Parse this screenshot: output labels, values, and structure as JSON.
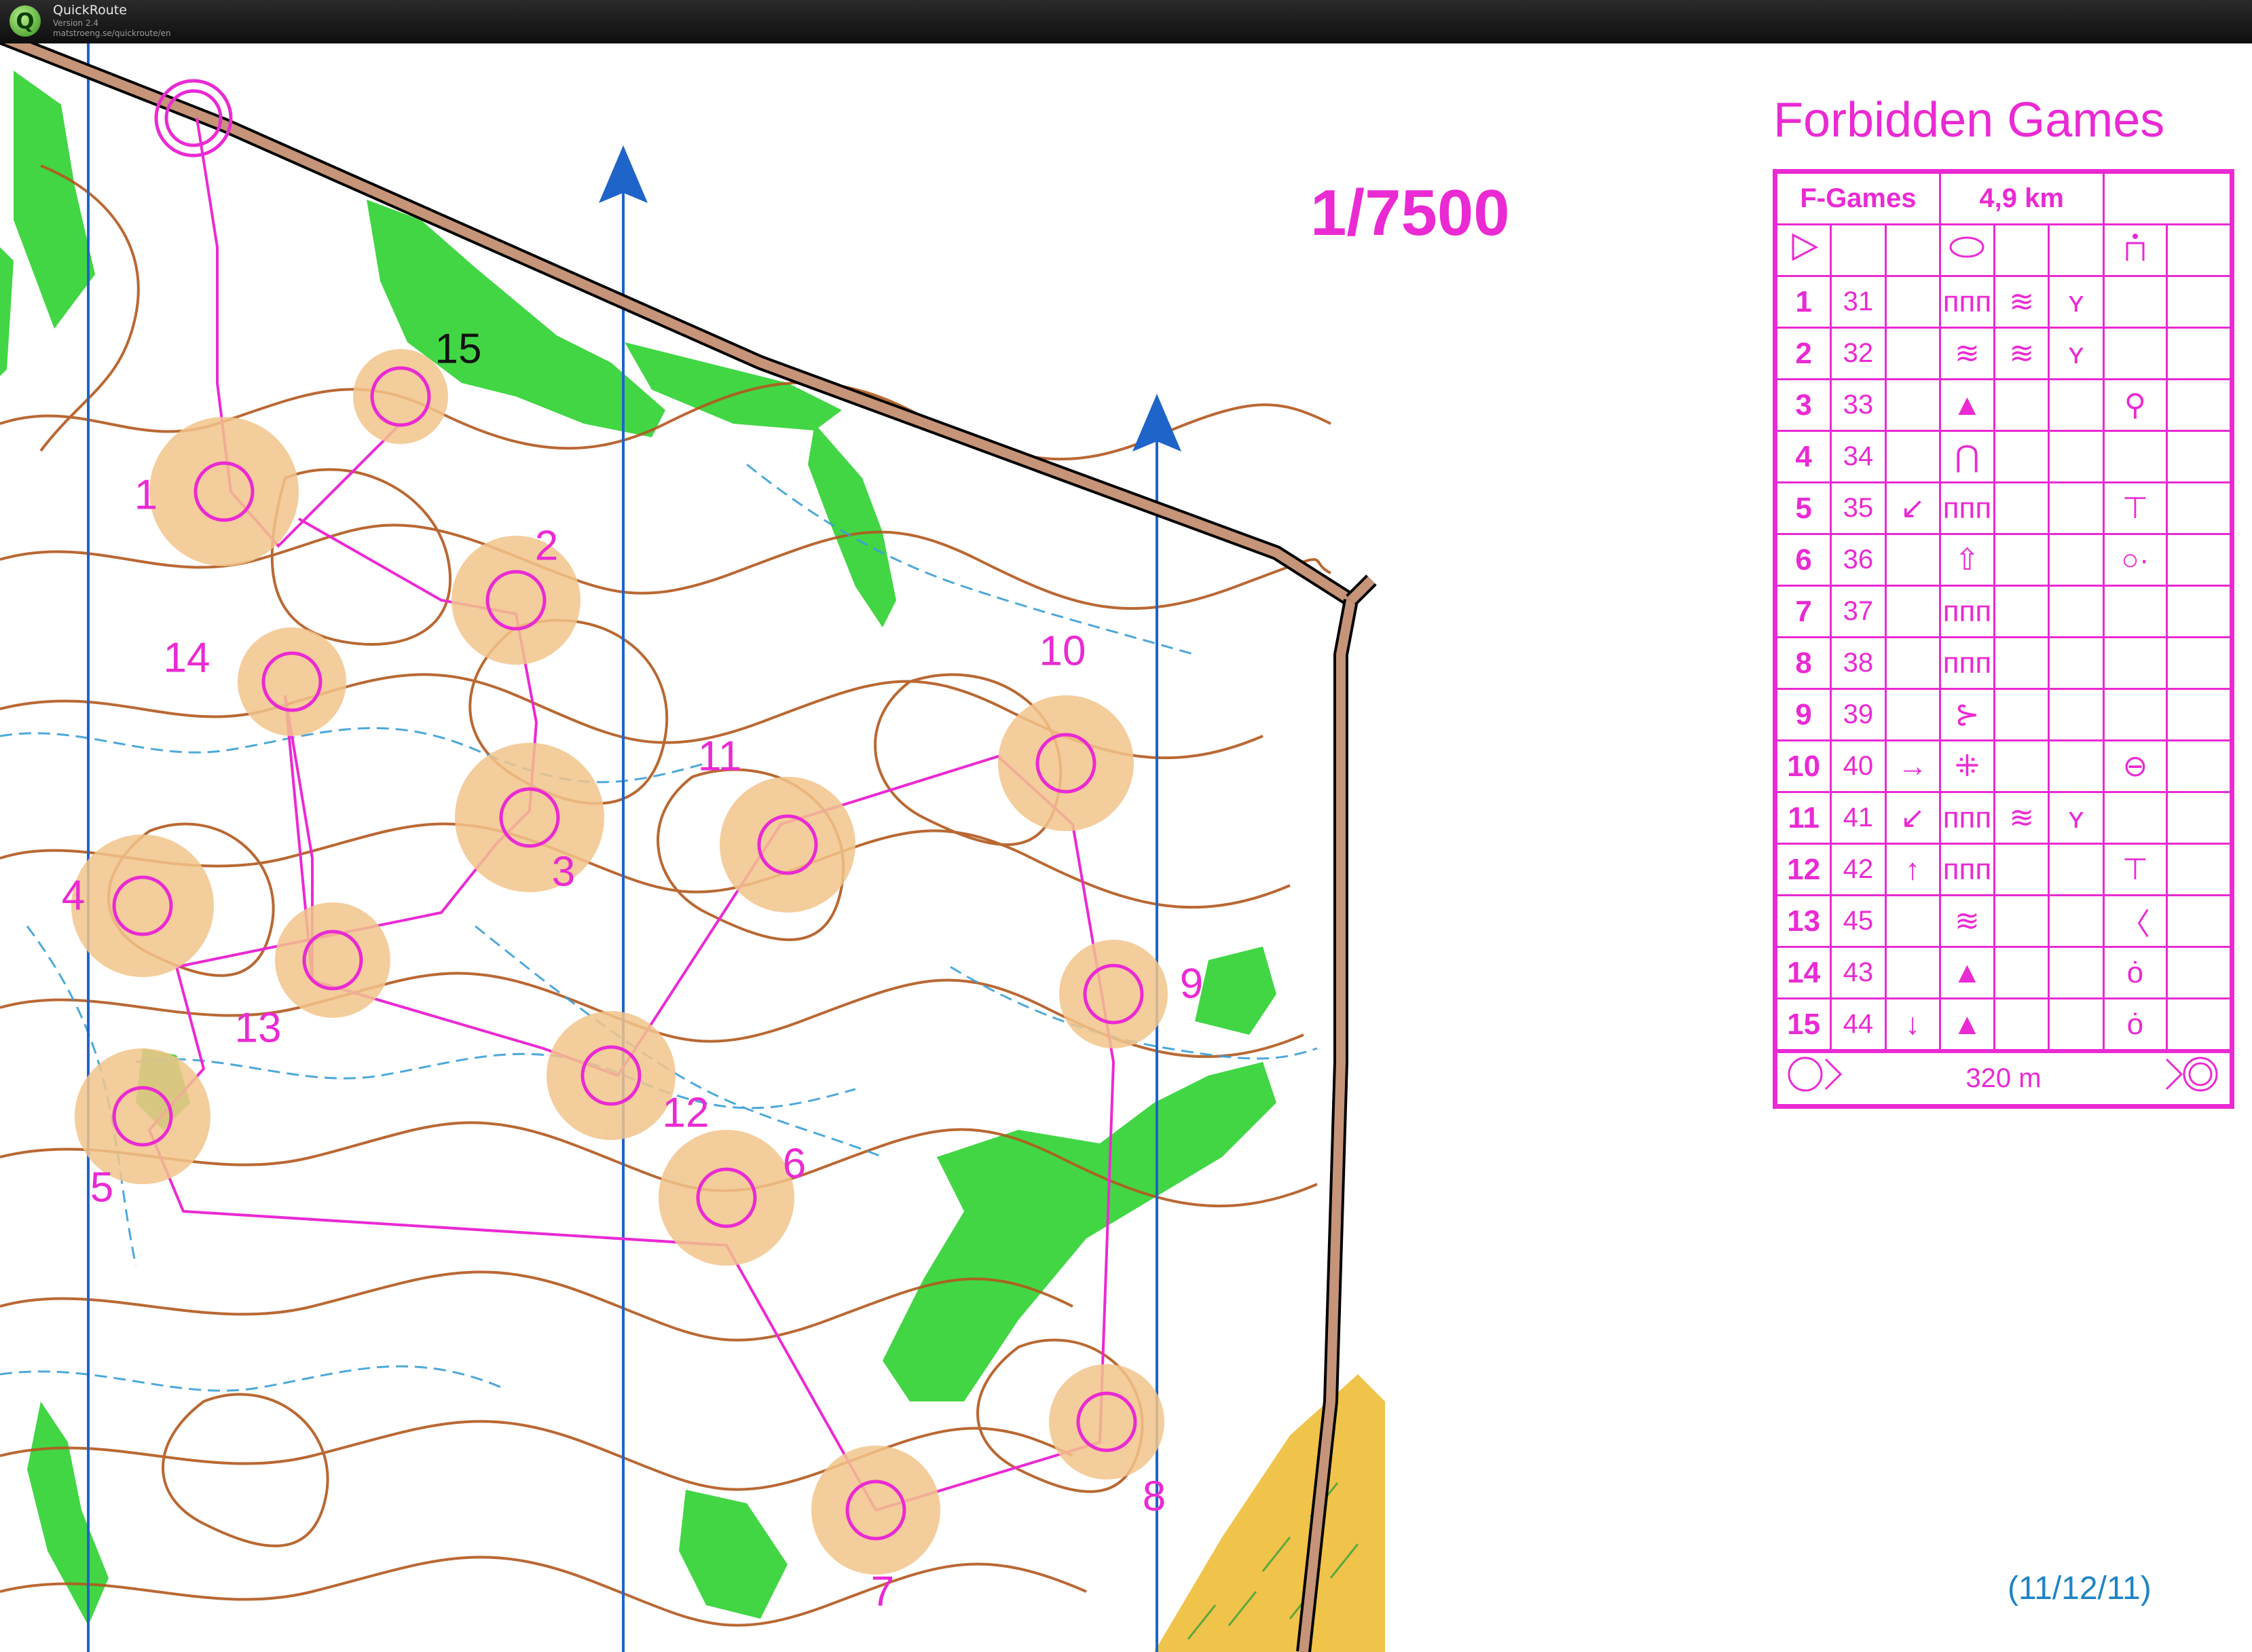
{
  "app": {
    "icon": "quickroute-logo-icon",
    "name": "QuickRoute",
    "version": "Version 2.4",
    "url": "matstroeng.se/quickroute/en"
  },
  "map": {
    "title": "Forbidden Games",
    "scale": "1/7500",
    "date": "(11/12/11)",
    "colors": {
      "course": "#ea2ad3",
      "contour": "#b2581e",
      "water": "#3a9fd6",
      "vegetation": "#38d43b",
      "north_line": "#1f64c8",
      "road": "#c69478"
    },
    "control_labels": [
      {
        "id": "1",
        "text": "1"
      },
      {
        "id": "2",
        "text": "2"
      },
      {
        "id": "3",
        "text": "3"
      },
      {
        "id": "4",
        "text": "4"
      },
      {
        "id": "5",
        "text": "5"
      },
      {
        "id": "6",
        "text": "6"
      },
      {
        "id": "7",
        "text": "7"
      },
      {
        "id": "8",
        "text": "8"
      },
      {
        "id": "9",
        "text": "9"
      },
      {
        "id": "10",
        "text": "10"
      },
      {
        "id": "11",
        "text": "11"
      },
      {
        "id": "12",
        "text": "12"
      },
      {
        "id": "13",
        "text": "13"
      },
      {
        "id": "14",
        "text": "14"
      },
      {
        "id": "15",
        "text": "15"
      }
    ]
  },
  "description_sheet": {
    "course_name": "F-Games",
    "length": "4,9 km",
    "start_row": {
      "start_symbol": "start-triangle-icon",
      "feature": "oval-icon",
      "other": "small-pit-icon"
    },
    "rows": [
      {
        "num": "1",
        "code": "31",
        "dir": "",
        "feature": "ᴨᴨᴨ",
        "appearance": "≋",
        "detail": "ʏ",
        "other": ""
      },
      {
        "num": "2",
        "code": "32",
        "dir": "",
        "feature": "≋",
        "appearance": "≋",
        "detail": "ʏ",
        "other": ""
      },
      {
        "num": "3",
        "code": "33",
        "dir": "",
        "feature": "▲",
        "appearance": "",
        "detail": "",
        "other": "⚲"
      },
      {
        "num": "4",
        "code": "34",
        "dir": "",
        "feature": "⋂",
        "appearance": "",
        "detail": "",
        "other": ""
      },
      {
        "num": "5",
        "code": "35",
        "dir": "↙",
        "feature": "ᴨᴨᴨ",
        "appearance": "",
        "detail": "",
        "other": "⊤"
      },
      {
        "num": "6",
        "code": "36",
        "dir": "",
        "feature": "⇧",
        "appearance": "",
        "detail": "",
        "other": "○·"
      },
      {
        "num": "7",
        "code": "37",
        "dir": "",
        "feature": "ᴨᴨᴨ",
        "appearance": "",
        "detail": "",
        "other": ""
      },
      {
        "num": "8",
        "code": "38",
        "dir": "",
        "feature": "ᴨᴨᴨ",
        "appearance": "",
        "detail": "",
        "other": ""
      },
      {
        "num": "9",
        "code": "39",
        "dir": "",
        "feature": "⊱",
        "appearance": "",
        "detail": "",
        "other": ""
      },
      {
        "num": "10",
        "code": "40",
        "dir": "→",
        "feature": "⁜",
        "appearance": "",
        "detail": "",
        "other": "⊖"
      },
      {
        "num": "11",
        "code": "41",
        "dir": "↙",
        "feature": "ᴨᴨᴨ",
        "appearance": "≋",
        "detail": "ʏ",
        "other": ""
      },
      {
        "num": "12",
        "code": "42",
        "dir": "↑",
        "feature": "ᴨᴨᴨ",
        "appearance": "",
        "detail": "",
        "other": "⊤"
      },
      {
        "num": "13",
        "code": "45",
        "dir": "",
        "feature": "≋",
        "appearance": "",
        "detail": "",
        "other": "〈"
      },
      {
        "num": "14",
        "code": "43",
        "dir": "",
        "feature": "▲",
        "appearance": "",
        "detail": "",
        "other": "ȯ"
      },
      {
        "num": "15",
        "code": "44",
        "dir": "↓",
        "feature": "▲",
        "appearance": "",
        "detail": "",
        "other": "ȯ"
      }
    ],
    "finish_distance": "320 m"
  }
}
